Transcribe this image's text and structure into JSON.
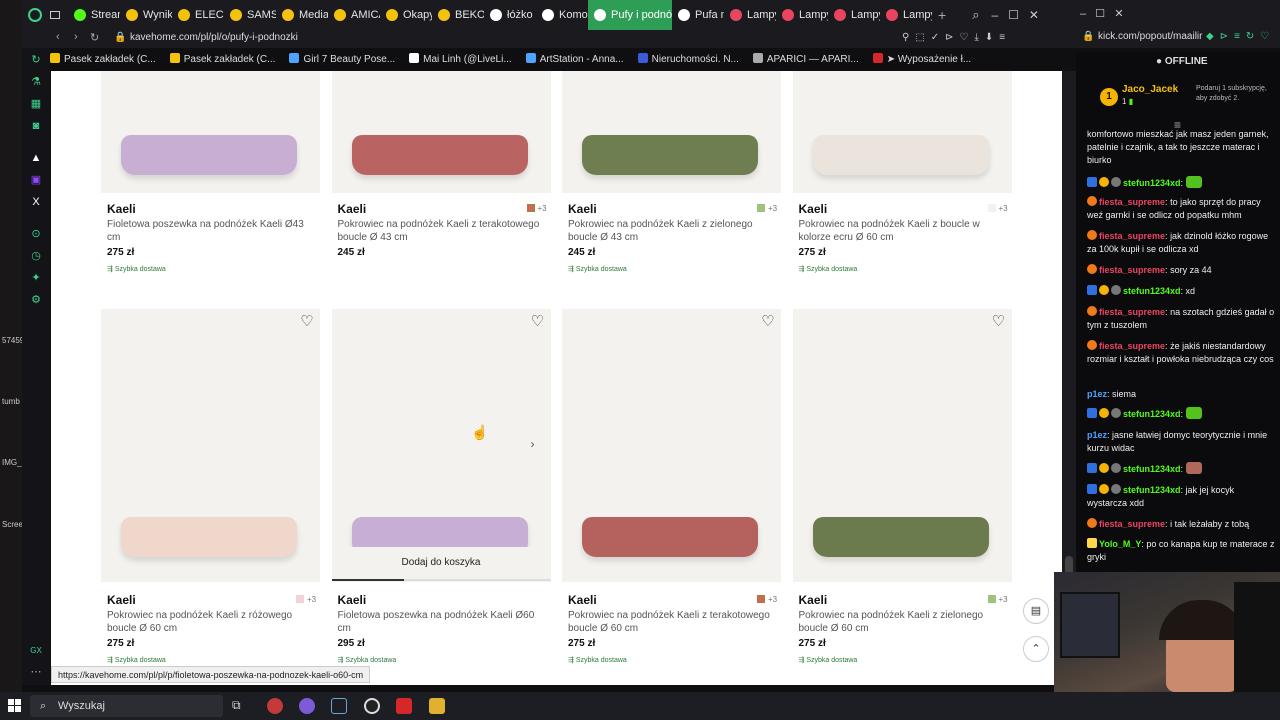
{
  "browser": {
    "tabs": [
      {
        "label": "Stream",
        "color": "#53fc18"
      },
      {
        "label": "Wynik",
        "color": "#f4c20d"
      },
      {
        "label": "ELECT",
        "color": "#f4c20d"
      },
      {
        "label": "SAMS",
        "color": "#f4c20d"
      },
      {
        "label": "Media",
        "color": "#f4c20d"
      },
      {
        "label": "AMICA",
        "color": "#f4c20d"
      },
      {
        "label": "Okapy",
        "color": "#f4c20d"
      },
      {
        "label": "BEKO",
        "color": "#f4c20d"
      },
      {
        "label": "łóżko",
        "color": "#ffffff"
      },
      {
        "label": "Komo",
        "color": "#ffffff"
      },
      {
        "label": "Pufy i podnó",
        "color": "#ffffff",
        "active": true
      },
      {
        "label": "Pufa n",
        "color": "#ffffff"
      },
      {
        "label": "Lampy",
        "color": "#e94560"
      },
      {
        "label": "Lampy",
        "color": "#e94560"
      },
      {
        "label": "Lampy",
        "color": "#e94560"
      },
      {
        "label": "Lampy",
        "color": "#e94560"
      }
    ],
    "url": "kavehome.com/pl/pl/o/pufy-i-podnozki",
    "bookmarks": [
      {
        "label": "Pasek zakładek (C...",
        "color": "#f4c20d"
      },
      {
        "label": "Pasek zakładek (C...",
        "color": "#f4c20d"
      },
      {
        "label": "Girl 7 Beauty Pose...",
        "color": "#4ea3ff"
      },
      {
        "label": "Mai Linh (@LiveLi...",
        "color": "#ffffff"
      },
      {
        "label": "ArtStation - Anna...",
        "color": "#4ea3ff"
      },
      {
        "label": "Nieruchomości. N...",
        "color": "#3b5bdb"
      },
      {
        "label": "APARICI — APARI...",
        "color": "#aaaaaa"
      },
      {
        "label": "➤ Wyposażenie ł...",
        "color": "#d62828"
      }
    ],
    "status_url": "https://kavehome.com/pl/pl/p/fioletowa-poszewka-na-podnozek-kaeli-o60-cm"
  },
  "products_row1": [
    {
      "brand": "Kaeli",
      "desc": "Fioletowa poszewka na podnóżek Kaeli Ø43 cm",
      "price": "275 zł",
      "ship": "Szybka dostawa",
      "swatch": "",
      "swatch_color": "",
      "pillow": "#c8aed3"
    },
    {
      "brand": "Kaeli",
      "desc": "Pokrowiec na podnóżek Kaeli z terakotowego boucle Ø 43 cm",
      "price": "245 zł",
      "ship": "",
      "swatch": "+3",
      "swatch_color": "#c0704f",
      "pillow": "#b96462"
    },
    {
      "brand": "Kaeli",
      "desc": "Pokrowiec na podnóżek Kaeli z zielonego boucle Ø 43 cm",
      "price": "245 zł",
      "ship": "Szybka dostawa",
      "swatch": "+3",
      "swatch_color": "#9ec27a",
      "pillow": "#6f7e51"
    },
    {
      "brand": "Kaeli",
      "desc": "Pokrowiec na podnóżek Kaeli z boucle w kolorze ecru Ø 60 cm",
      "price": "275 zł",
      "ship": "Szybka dostawa",
      "swatch": "+3",
      "swatch_color": "#f6f1e6",
      "pillow": "#ebe4dd"
    }
  ],
  "products_row2": [
    {
      "brand": "Kaeli",
      "desc": "Pokrowiec na podnóżek Kaeli z różowego boucle Ø 60 cm",
      "price": "275 zł",
      "ship": "Szybka dostawa",
      "swatch": "+3",
      "swatch_color": "#f1d4d7",
      "pillow": "#efd8cb"
    },
    {
      "brand": "Kaeli",
      "desc": "Fioletowa poszewka na podnóżek Kaeli Ø60 cm",
      "price": "295 zł",
      "ship": "Szybka dostawa",
      "swatch": "",
      "swatch_color": "",
      "pillow": "#c7aed4",
      "add_to_cart": "Dodaj do koszyka"
    },
    {
      "brand": "Kaeli",
      "desc": "Pokrowiec na podnóżek Kaeli z terakotowego boucle Ø 60 cm",
      "price": "275 zł",
      "ship": "Szybka dostawa",
      "swatch": "+3",
      "swatch_color": "#c0704f",
      "pillow": "#b5625f"
    },
    {
      "brand": "Kaeli",
      "desc": "Pokrowiec na podnóżek Kaeli z zielonego boucle Ø 60 cm",
      "price": "275 zł",
      "ship": "Szybka dostawa",
      "swatch": "+3",
      "swatch_color": "#9ec27a",
      "pillow": "#6c7b4e"
    }
  ],
  "kick": {
    "url": "kick.com/popout/maailir",
    "status": "OFFLINE",
    "top_user": "Jaco_Jacek",
    "top_rank": "1",
    "top_count": "1",
    "subgoal": "Podaruj 1 subskrypcję, aby zdobyć 2.",
    "messages": [
      {
        "user": "",
        "text": "komfortowo mieszkać jak masz jeden garnek, patelnie i czajnik, a tak to jeszcze materac i biurko",
        "color": ""
      },
      {
        "user": "stefun1234xd",
        "text": "",
        "color": "green"
      },
      {
        "user": "fiesta_supreme",
        "text": "to jako sprzęt do pracy weź garnki i se odlicz od popatku mhm",
        "color": "red"
      },
      {
        "user": "fiesta_supreme",
        "text": "jak dzinold łóżko rogowe za 100k kupił i se odlicza xd",
        "color": "red"
      },
      {
        "user": "fiesta_supreme",
        "text": "sory za 44",
        "color": "red"
      },
      {
        "user": "stefun1234xd",
        "text": "xd",
        "color": "green"
      },
      {
        "user": "fiesta_supreme",
        "text": "na szotach gdzieś gadał o tym z tuszolem",
        "color": "red"
      },
      {
        "user": "fiesta_supreme",
        "text": "że jakiś niestandardowy rozmiar i kształt i powłoka niebrudząca czy cos",
        "color": "red"
      },
      {
        "user": "p1ez",
        "text": "siema",
        "color": "blue"
      },
      {
        "user": "stefun1234xd",
        "text": "",
        "color": "green"
      },
      {
        "user": "p1ez",
        "text": "jasne łatwiej domyc teorytycznie i mnie kurzu widac",
        "color": "blue"
      },
      {
        "user": "stefun1234xd",
        "text": "",
        "color": "green"
      },
      {
        "user": "stefun1234xd",
        "text": "jak jej kocyk wystarcza xdd",
        "color": "green"
      },
      {
        "user": "fiesta_supreme",
        "text": "i tak leżałaby z tobą",
        "color": "red"
      },
      {
        "user": "Yolo_M_Y",
        "text": "po co kanapa kup te materace z gryki",
        "color": "green"
      }
    ]
  },
  "desktop_labels": [
    "57459",
    "tumb",
    "IMG_",
    "Scree"
  ],
  "taskbar": {
    "search": "Wyszukaj"
  },
  "rail": {
    "gx": "GX"
  }
}
